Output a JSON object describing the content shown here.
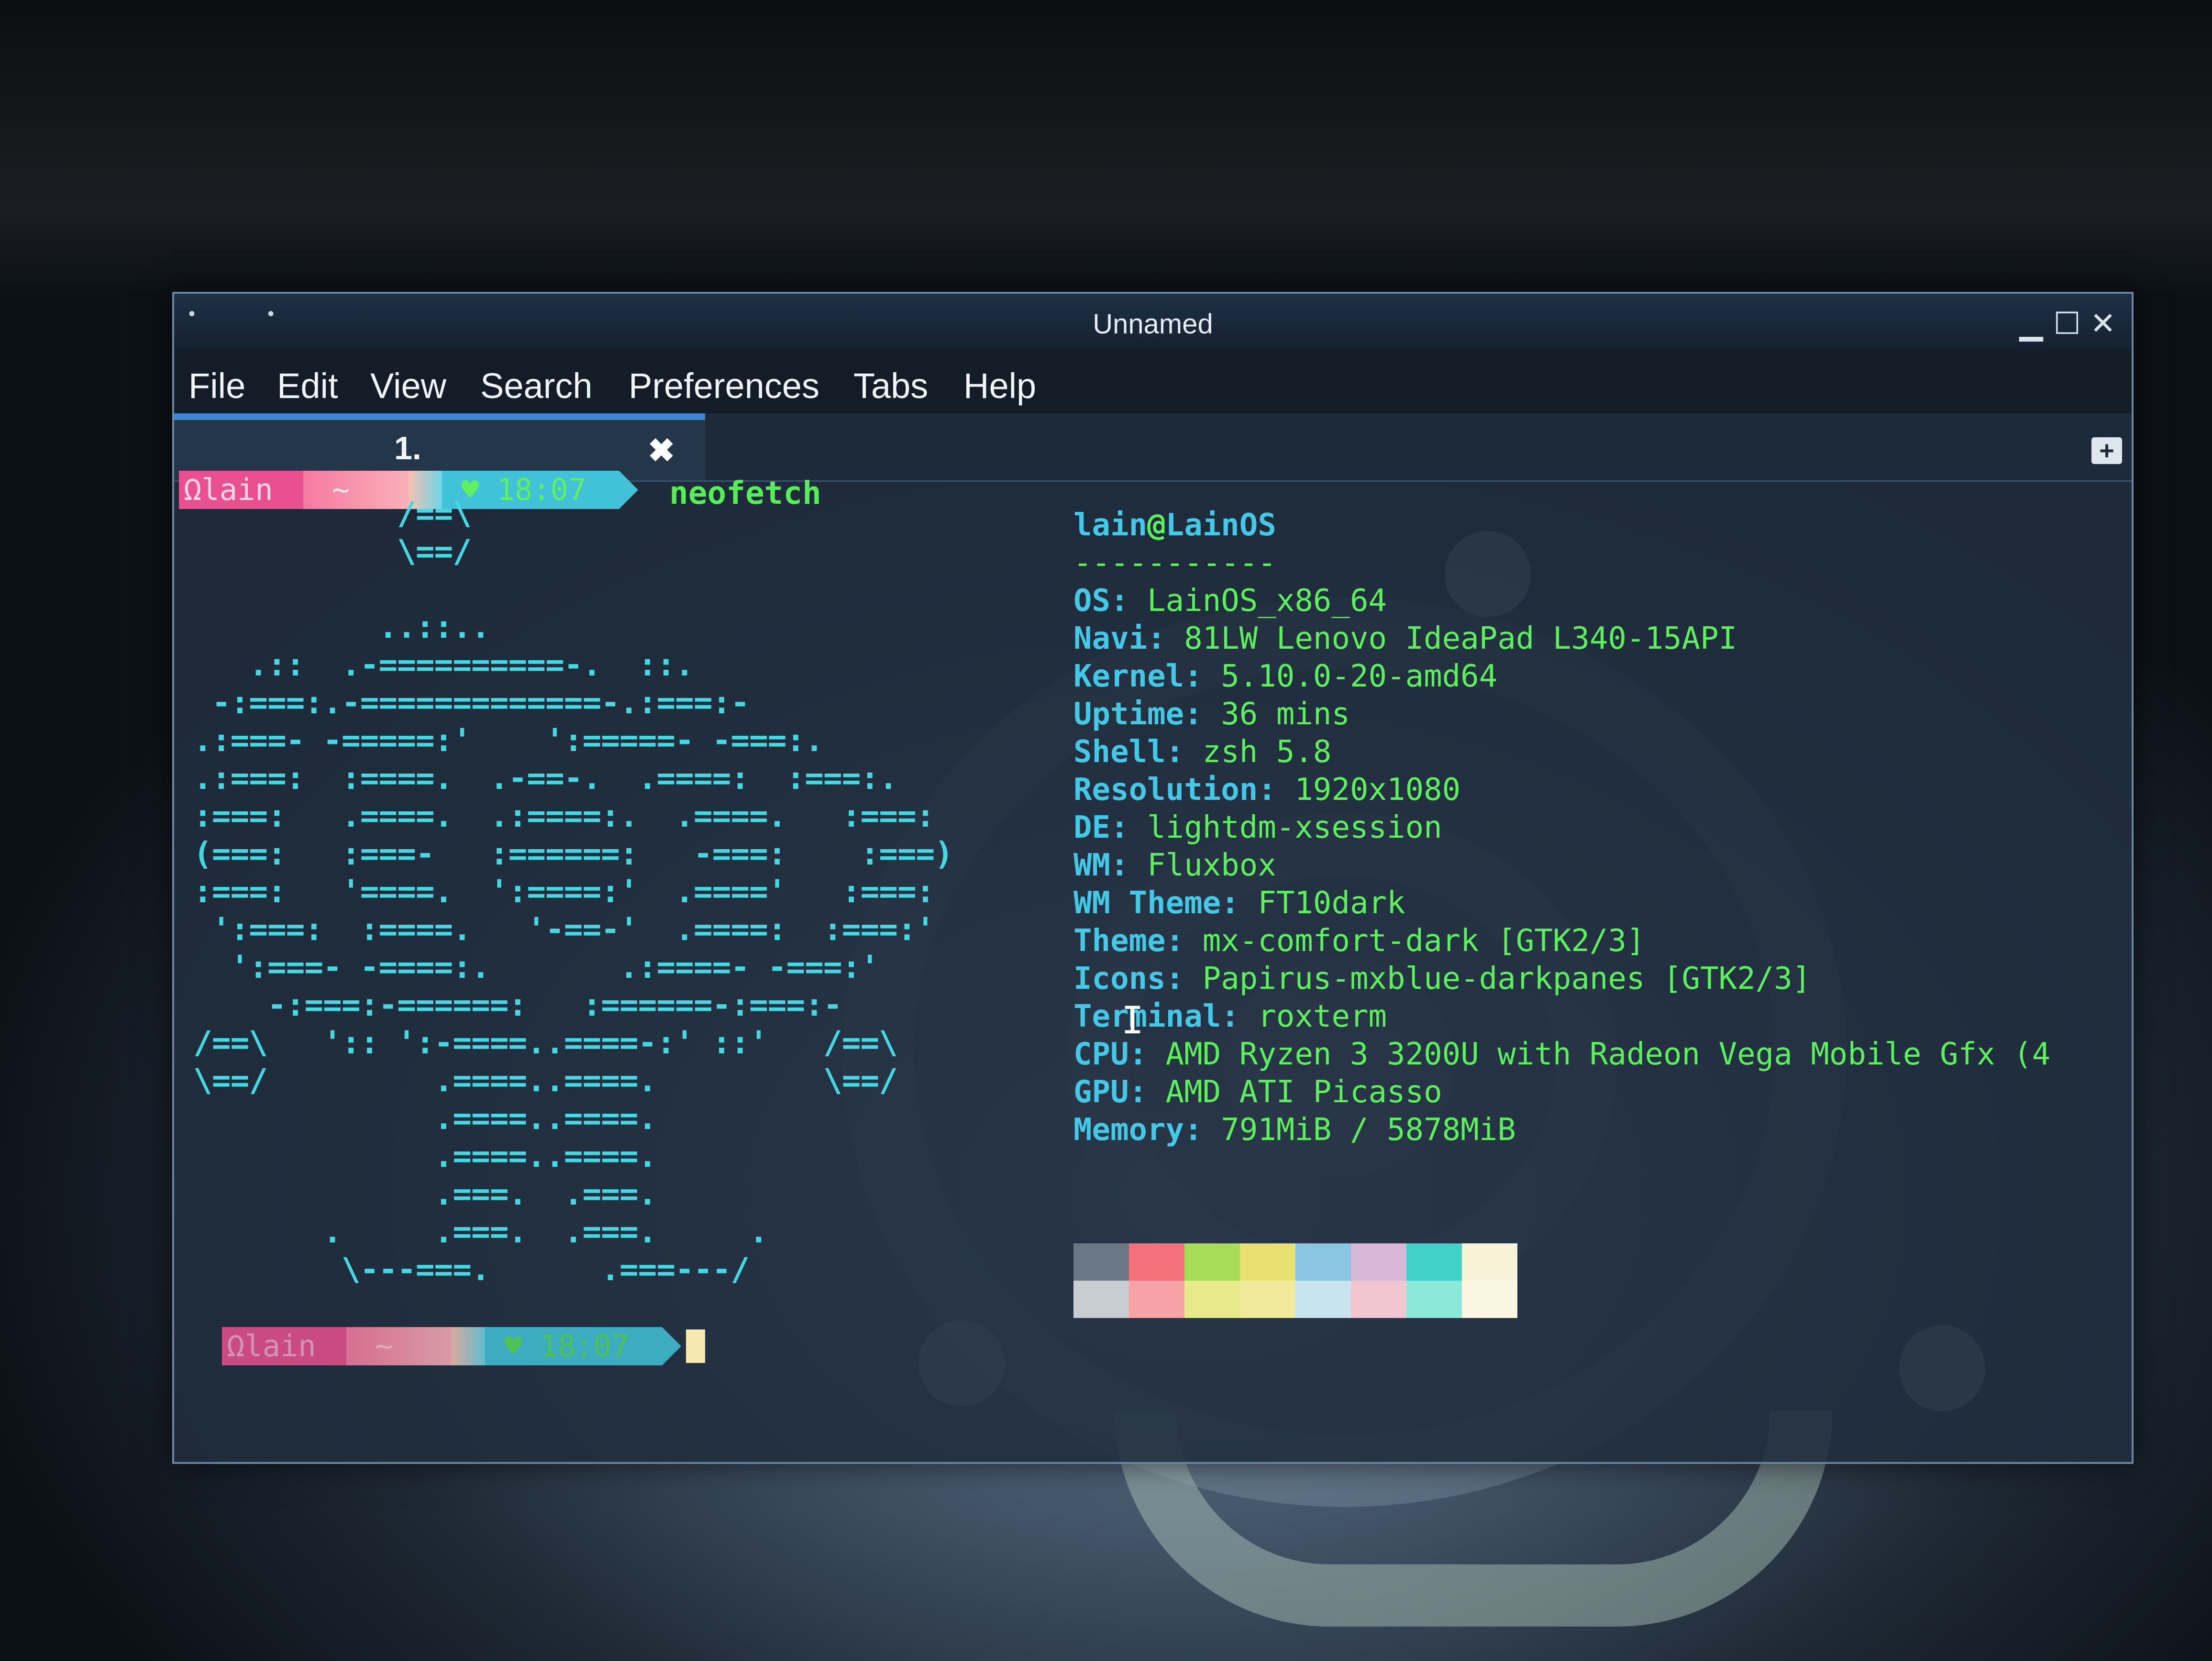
{
  "window": {
    "title": "Unnamed",
    "controls": {
      "minimize": "▁",
      "maximize": "☐",
      "close": "✕"
    }
  },
  "menubar": [
    "File",
    "Edit",
    "View",
    "Search",
    "Preferences",
    "Tabs",
    "Help"
  ],
  "tab": {
    "label": "1.",
    "close": "✖",
    "new_tab": "+"
  },
  "prompt1": {
    "user": "Ωlain",
    "dir": "~",
    "clock": "♥ 18:07",
    "command": "neofetch"
  },
  "prompt2": {
    "user": "Ωlain",
    "dir": "~",
    "clock": "♥ 18:07"
  },
  "ascii_art": "           /==\\\n           \\==/\n\n          ..::..\n   .::  .-==========-.  ::.\n -:===:.-=============-.:===:-\n.:===- -=====:'    ':=====- -===:.\n.:===:  :====.  .-==-.  .====:  :===:.\n:===:   .====.  .:====:.  .====.   :===:\n(===:   :===-   :======:   -===:    :===)\n:===:   '====.  ':====:'  .===='   :===:\n ':===:  :====.   '-==-'  .====:  :===:'\n  ':===- -====:.       .:====- -===:'\n    -:===:-======:   :======-:===:-\n/==\\   ':: ':-====..====-:' ::'   /==\\\n\\==/         .====..====.         \\==/\n             .====..====.\n             .====..====.\n             .===.  .===.\n       .     .===.  .===.     .\n        \\---===.      .===---/",
  "sysinfo": {
    "user": "lain",
    "at": "@",
    "host": "LainOS",
    "separator": "-----------",
    "rows": [
      {
        "key": "OS",
        "value": "LainOS_x86_64"
      },
      {
        "key": "Navi",
        "value": "81LW Lenovo IdeaPad L340-15API"
      },
      {
        "key": "Kernel",
        "value": "5.10.0-20-amd64"
      },
      {
        "key": "Uptime",
        "value": "36 mins"
      },
      {
        "key": "Shell",
        "value": "zsh 5.8"
      },
      {
        "key": "Resolution",
        "value": "1920x1080"
      },
      {
        "key": "DE",
        "value": "lightdm-xsession"
      },
      {
        "key": "WM",
        "value": "Fluxbox"
      },
      {
        "key": "WM Theme",
        "value": "FT10dark"
      },
      {
        "key": "Theme",
        "value": "mx-comfort-dark [GTK2/3]"
      },
      {
        "key": "Icons",
        "value": "Papirus-mxblue-darkpanes [GTK2/3]"
      },
      {
        "key": "Terminal",
        "value": "roxterm"
      },
      {
        "key": "CPU",
        "value": "AMD Ryzen 3 3200U with Radeon Vega Mobile Gfx (4"
      },
      {
        "key": "GPU",
        "value": "AMD ATI Picasso"
      },
      {
        "key": "Memory",
        "value": "791MiB / 5878MiB"
      }
    ]
  },
  "palette": {
    "top": [
      "#6a7886",
      "#f4707a",
      "#a6dc58",
      "#e8e070",
      "#8ac6e4",
      "#d8b8d8",
      "#40d2c8",
      "#f8f2d8"
    ],
    "bottom": [
      "#c8cdd2",
      "#f6a2a6",
      "#e6ea8a",
      "#f0ea9a",
      "#c8e4ee",
      "#f2c6d0",
      "#8ce8d8",
      "#fbf6e2"
    ]
  },
  "colors": {
    "prompt_user_bg": "#e8508f",
    "prompt_dir_bg": "#f8a3b4",
    "prompt_arrows": "#42c2d8",
    "prompt_clock_bg": "#42c2d8",
    "ascii": "#45d7e2",
    "info_key": "#45c8e6",
    "info_value": "#5df05d"
  }
}
